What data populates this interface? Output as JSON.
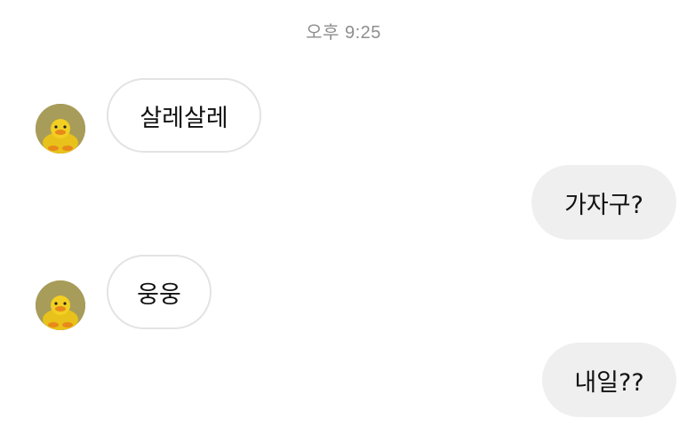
{
  "header": {
    "timestamp": "오후 9:25"
  },
  "colors": {
    "incoming_bubble_bg": "#ffffff",
    "incoming_bubble_border": "#e3e3e3",
    "outgoing_bubble_bg": "#efefef",
    "timestamp_text": "#8e8e8e",
    "message_text": "#111111"
  },
  "messages": [
    {
      "sender": "other",
      "text": "살레살레",
      "avatar_icon": "yellow-duck-avatar"
    },
    {
      "sender": "me",
      "text": "가자구?"
    },
    {
      "sender": "other",
      "text": "웅웅",
      "avatar_icon": "yellow-duck-avatar"
    },
    {
      "sender": "me",
      "text": "내일??"
    }
  ]
}
